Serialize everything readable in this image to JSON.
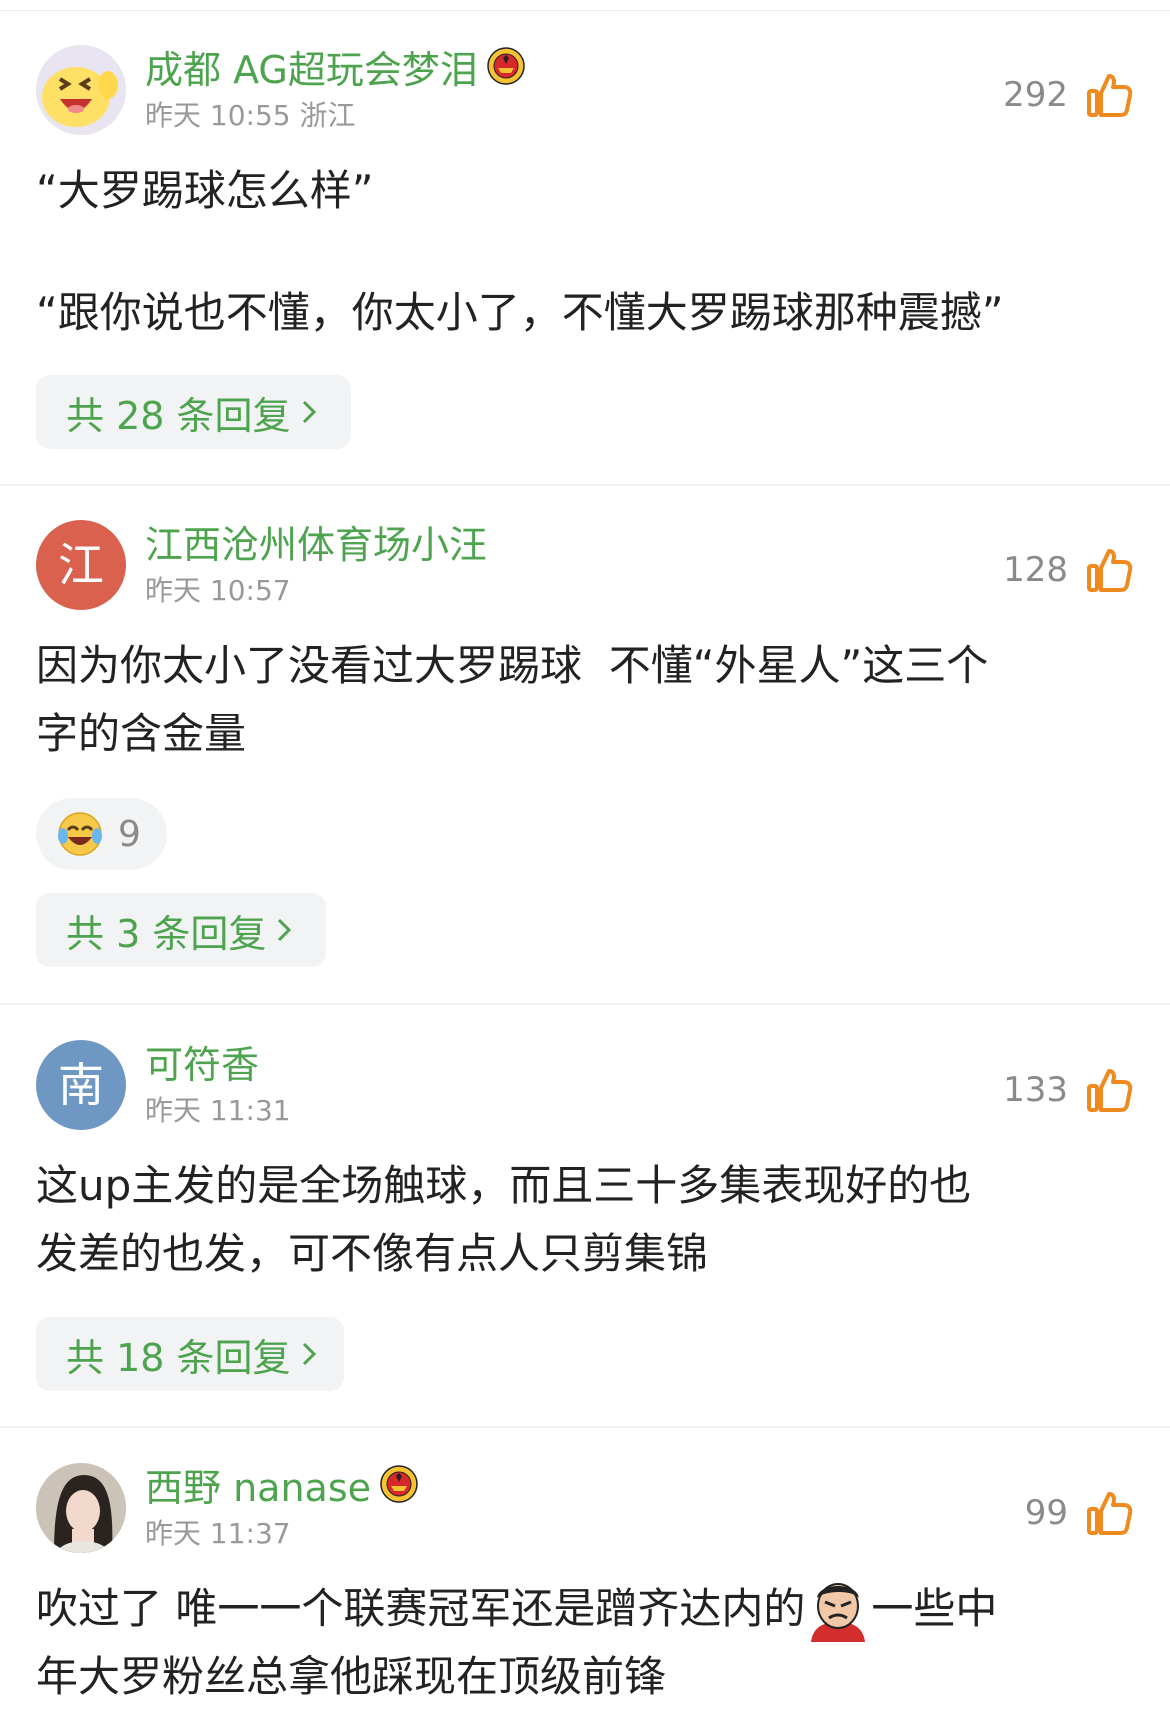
{
  "colors": {
    "username": "#4ea44e",
    "avatar_red": "#d9614e",
    "avatar_blue": "#6f97c4"
  },
  "comments": [
    {
      "username": "成都 AG超玩会梦泪",
      "time": "昨天 10:55 浙江",
      "likes": "292",
      "avatar": "laughing-chick-avatar",
      "badge": "man-utd-badge-icon",
      "text_lines": [
        "“大罗踢球怎么样”",
        "",
        "“跟你说也不懂，你太小了，不懂大罗踢球那种震撼”"
      ],
      "replies": "共 28 条回复"
    },
    {
      "username": "江西沧州体育场小汪",
      "time": "昨天 10:57",
      "likes": "128",
      "avatar_letter": "江",
      "text_lines": [
        "因为你太小了没看过大罗踢球  不懂“外星人”这三个",
        "字的含金量"
      ],
      "reaction_count": "9",
      "reaction_icon": "tears-of-joy-emoji-icon",
      "replies": "共 3 条回复"
    },
    {
      "username": "可符香",
      "time": "昨天 11:31",
      "likes": "133",
      "avatar_letter": "南",
      "text_lines": [
        "这up主发的是全场触球，而且三十多集表现好的也",
        "发差的也发，可不像有点人只剪集锦"
      ],
      "replies": "共 18 条回复"
    },
    {
      "username": "西野 nanase",
      "time": "昨天 11:37",
      "likes": "99",
      "avatar": "photo-avatar",
      "badge": "man-utd-badge-icon",
      "text_before_emoji": "吹过了 唯一一个联赛冠军还是蹭齐达内的",
      "inline_emoji": "angry-face-sticker-icon",
      "text_after_emoji": "一些中",
      "text_line2": "年大罗粉丝总拿他踩现在顶级前锋"
    }
  ]
}
